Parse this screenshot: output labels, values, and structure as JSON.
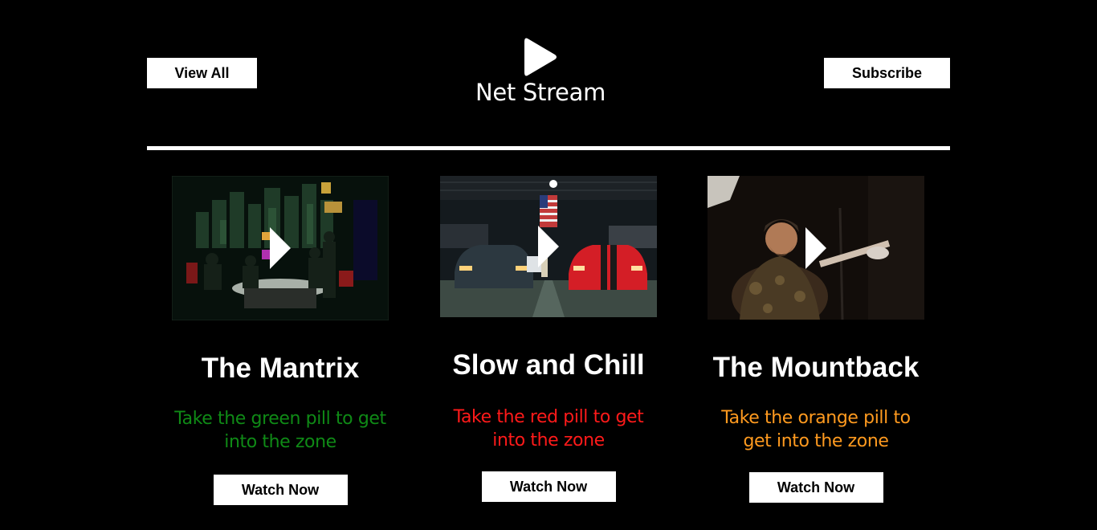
{
  "header": {
    "view_all_label": "View All",
    "subscribe_label": "Subscribe",
    "brand_name": "Net Stream",
    "brand_icon": "play-icon"
  },
  "colors": {
    "background": "#000000",
    "button_bg": "#ffffff",
    "green": "#0f8a16",
    "red": "#ff1a1a",
    "orange": "#ff9a1f"
  },
  "movies": [
    {
      "title": "The Mantrix",
      "description": "Take the green pill to get into the zone",
      "watch_label": "Watch Now",
      "accent": "#0f8a16"
    },
    {
      "title": "Slow and Chill",
      "description": "Take the red pill to get into the zone",
      "watch_label": "Watch Now",
      "accent": "#ff1a1a"
    },
    {
      "title": "The Mountback",
      "description": "Take the orange pill to get into the zone",
      "watch_label": "Watch Now",
      "accent": "#ff9a1f"
    }
  ]
}
